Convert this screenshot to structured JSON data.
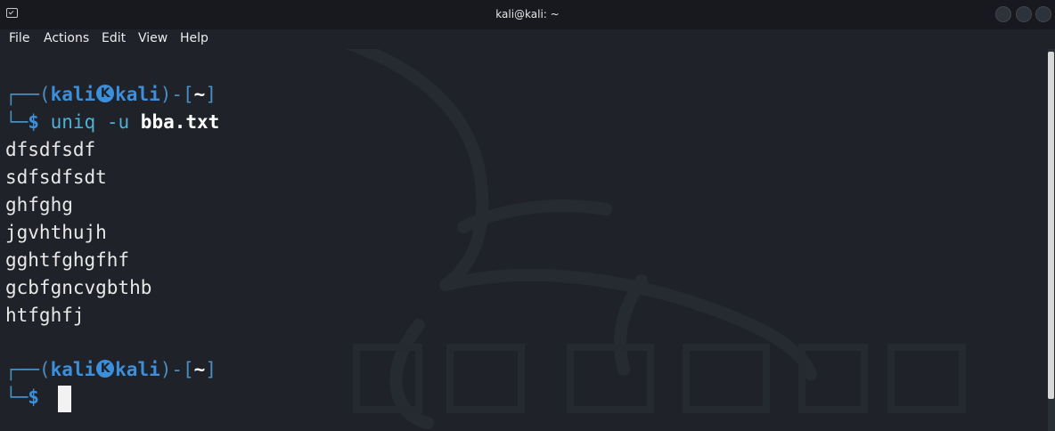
{
  "window": {
    "title": "kali@kali: ~"
  },
  "menu": {
    "file": "File",
    "actions": "Actions",
    "edit": "Edit",
    "view": "View",
    "help": "Help"
  },
  "prompt": {
    "top_left": "┌──(",
    "user": "kali",
    "host": "kali",
    "mid": ")-[",
    "path": "~",
    "close": "]",
    "bottom_left": "└─",
    "dollar": "$"
  },
  "command": {
    "name": "uniq",
    "flag": "-u",
    "arg": "bba.txt"
  },
  "output": [
    "dfsdfsdf",
    "sdfsdfsdt",
    "ghfghg",
    "jgvhthujh",
    "gghtfghgfhf",
    "gcbfgncvgbthb",
    "htfghfj"
  ],
  "icons": {
    "terminal": "terminal-icon",
    "kali": "kali-logo-icon",
    "minimize": "minimize-icon",
    "maximize": "maximize-icon",
    "close": "close-icon"
  },
  "colors": {
    "background": "#1f2229",
    "prompt_blue": "#3c8fdb",
    "command_cyan": "#4fb0d6",
    "frame": "#4a8ec0"
  }
}
